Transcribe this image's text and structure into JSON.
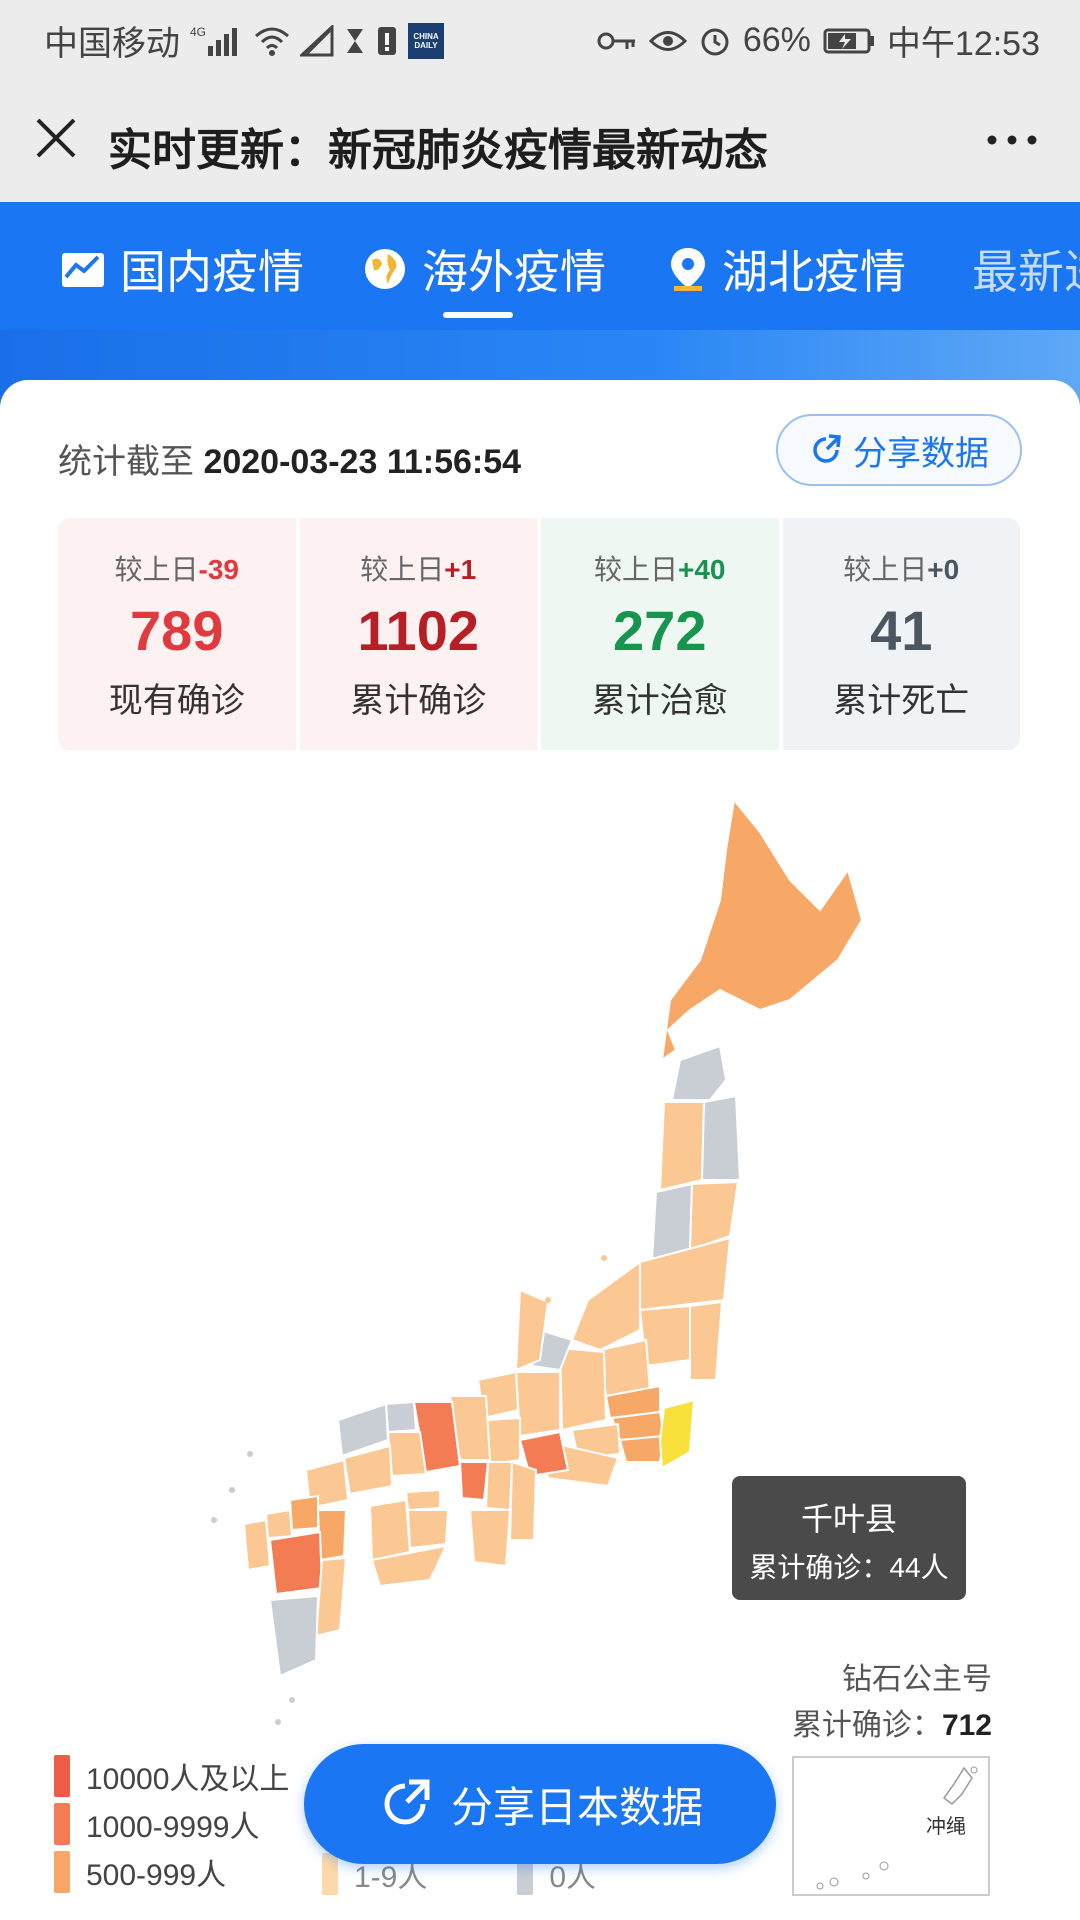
{
  "status_bar": {
    "carrier": "中国移动",
    "network": "4G",
    "app_badge": "CHINA DAILY",
    "battery": "66%",
    "time": "中午12:53"
  },
  "title_bar": {
    "title": "实时更新：新冠肺炎疫情最新动态"
  },
  "tabs": [
    {
      "label": "国内疫情",
      "icon": "chart-icon"
    },
    {
      "label": "海外疫情",
      "icon": "globe-icon",
      "active": true
    },
    {
      "label": "湖北疫情",
      "icon": "location-pin-icon"
    },
    {
      "label": "最新进"
    }
  ],
  "stats_header": {
    "prefix": "统计截至",
    "timestamp": "2020-03-23 11:56:54",
    "share_label": "分享数据"
  },
  "stats": [
    {
      "delta_label": "较上日",
      "delta": "-39",
      "value": "789",
      "label": "现有确诊",
      "color": "#e0393e",
      "bg": "#fdf1f1",
      "delta_color": "#e0393e"
    },
    {
      "delta_label": "较上日",
      "delta": "+1",
      "value": "1102",
      "label": "累计确诊",
      "color": "#b51f25",
      "bg": "#fdf1f1",
      "delta_color": "#b51f25"
    },
    {
      "delta_label": "较上日",
      "delta": "+40",
      "value": "272",
      "label": "累计治愈",
      "color": "#17944d",
      "bg": "#eef7f2",
      "delta_color": "#17944d"
    },
    {
      "delta_label": "较上日",
      "delta": "+0",
      "value": "41",
      "label": "累计死亡",
      "color": "#4b5660",
      "bg": "#f0f3f5",
      "delta_color": "#4b5660"
    }
  ],
  "map": {
    "tooltip": {
      "title": "千叶县",
      "subtitle": "累计确诊：44人"
    },
    "source_name": "钻石公主号",
    "total_prefix": "累计确诊：",
    "total_value": "712",
    "inset_label": "冲绳",
    "colors": {
      "very_high": "#ef5b47",
      "high": "#f47c55",
      "mid": "#f8a866",
      "low": "#fbc893",
      "lowest": "#fde3c4",
      "zero": "#c9cdd4",
      "highlight": "#f7e13a"
    }
  },
  "legend": [
    {
      "label": "10000人及以上",
      "color": "#ef5b47"
    },
    {
      "label": "1000-9999人",
      "color": "#f47c55"
    },
    {
      "label": "500-999人",
      "color": "#f8a866"
    }
  ],
  "legend_extra": [
    {
      "label": "1-9人",
      "color": "#fcd9a8"
    },
    {
      "label": "0人",
      "color": "#c9cdd4"
    }
  ],
  "share_japan_label": "分享日本数据"
}
